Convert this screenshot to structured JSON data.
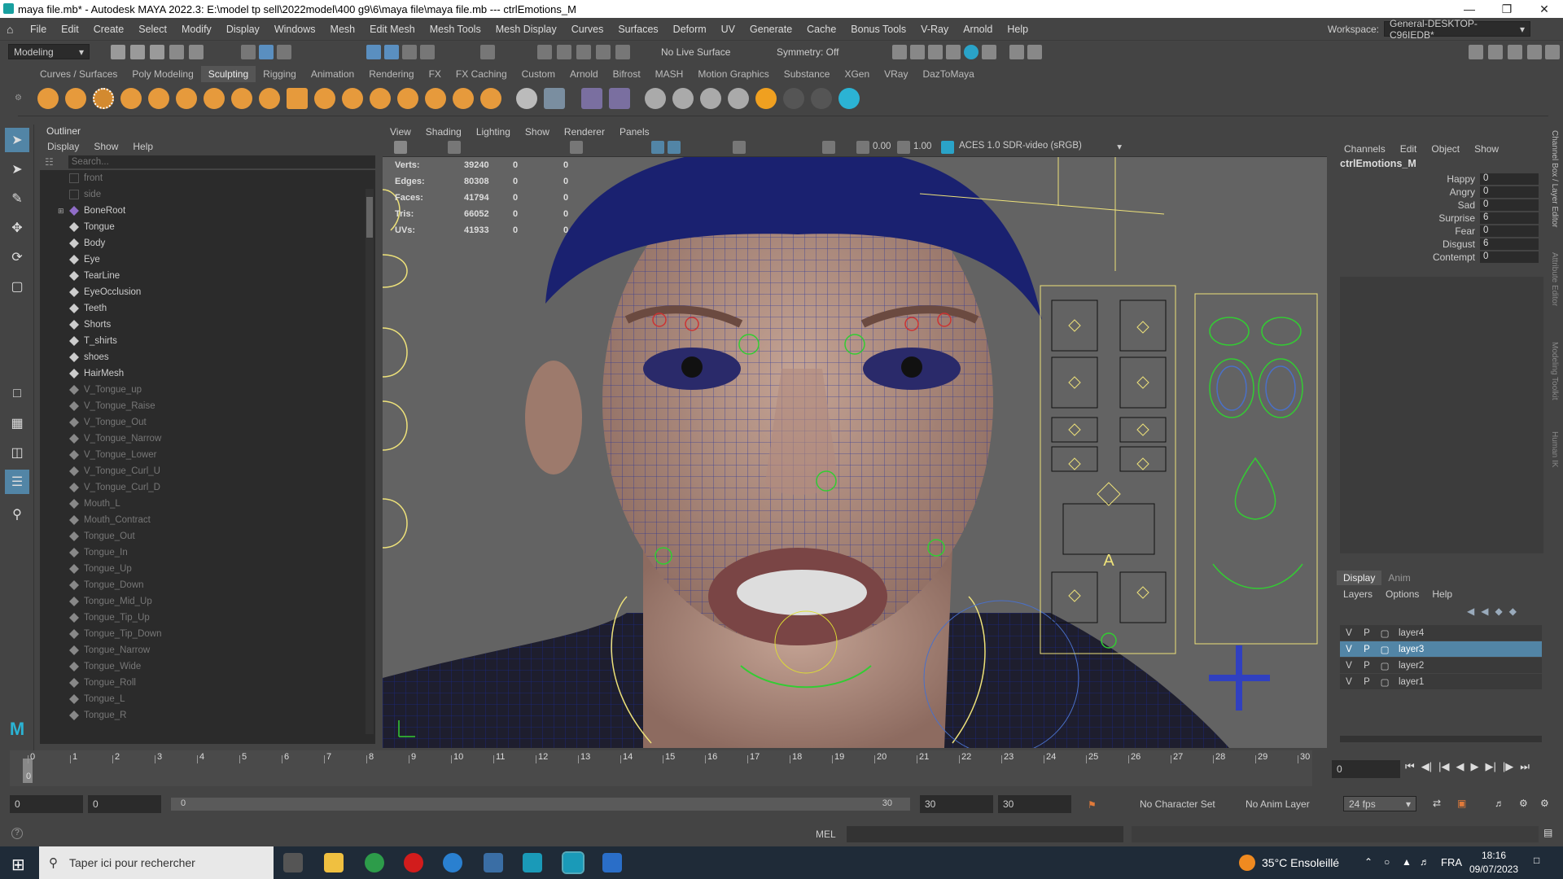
{
  "window": {
    "title": "maya file.mb* - Autodesk MAYA 2022.3: E:\\model tp sell\\2022model\\400 g9\\6\\maya file\\maya file.mb  ---  ctrlEmotions_M"
  },
  "menubar": {
    "items": [
      "File",
      "Edit",
      "Create",
      "Select",
      "Modify",
      "Display",
      "Windows",
      "Mesh",
      "Edit Mesh",
      "Mesh Tools",
      "Mesh Display",
      "Curves",
      "Surfaces",
      "Deform",
      "UV",
      "Generate",
      "Cache",
      "Bonus Tools",
      "V-Ray",
      "Arnold",
      "Help"
    ],
    "workspace_label": "Workspace:",
    "workspace_value": "General-DESKTOP-C96IEDB*"
  },
  "statusline": {
    "mode": "Modeling",
    "live_surface": "No Live Surface",
    "symmetry": "Symmetry: Off"
  },
  "shelf": {
    "tabs": [
      "Curves / Surfaces",
      "Poly Modeling",
      "Sculpting",
      "Rigging",
      "Animation",
      "Rendering",
      "FX",
      "FX Caching",
      "Custom",
      "Arnold",
      "Bifrost",
      "MASH",
      "Motion Graphics",
      "Substance",
      "XGen",
      "VRay",
      "DazToMaya"
    ],
    "selected_tab": "Sculpting"
  },
  "outliner": {
    "title": "Outliner",
    "menu": [
      "Display",
      "Show",
      "Help"
    ],
    "search_placeholder": "Search...",
    "items": [
      "front",
      "side",
      "BoneRoot",
      "Tongue",
      "Body",
      "Eye",
      "TearLine",
      "EyeOcclusion",
      "Teeth",
      "Shorts",
      "T_shirts",
      "shoes",
      "HairMesh",
      "V_Tongue_up",
      "V_Tongue_Raise",
      "V_Tongue_Out",
      "V_Tongue_Narrow",
      "V_Tongue_Lower",
      "V_Tongue_Curl_U",
      "V_Tongue_Curl_D",
      "Mouth_L",
      "Mouth_Contract",
      "Tongue_Out",
      "Tongue_In",
      "Tongue_Up",
      "Tongue_Down",
      "Tongue_Mid_Up",
      "Tongue_Tip_Up",
      "Tongue_Tip_Down",
      "Tongue_Narrow",
      "Tongue_Wide",
      "Tongue_Roll",
      "Tongue_L",
      "Tongue_R"
    ]
  },
  "viewport": {
    "menu": [
      "View",
      "Shading",
      "Lighting",
      "Show",
      "Renderer",
      "Panels"
    ],
    "exposure": "0.00",
    "gamma": "1.00",
    "colorspace": "ACES 1.0 SDR-video (sRGB)",
    "hud": [
      {
        "label": "Verts:",
        "v1": "39240",
        "v2": "0",
        "v3": "0"
      },
      {
        "label": "Edges:",
        "v1": "80308",
        "v2": "0",
        "v3": "0"
      },
      {
        "label": "Faces:",
        "v1": "41794",
        "v2": "0",
        "v3": "0"
      },
      {
        "label": "Tris:",
        "v1": "66052",
        "v2": "0",
        "v3": "0"
      },
      {
        "label": "UVs:",
        "v1": "41933",
        "v2": "0",
        "v3": "0"
      }
    ],
    "panel_letter": "A"
  },
  "channelbox": {
    "menu": [
      "Channels",
      "Edit",
      "Object",
      "Show"
    ],
    "node": "ctrlEmotions_M",
    "attrs": [
      {
        "name": "Happy",
        "value": "0"
      },
      {
        "name": "Angry",
        "value": "0"
      },
      {
        "name": "Sad",
        "value": "0"
      },
      {
        "name": "Surprise",
        "value": "6"
      },
      {
        "name": "Fear",
        "value": "0"
      },
      {
        "name": "Disgust",
        "value": "6"
      },
      {
        "name": "Contempt",
        "value": "0"
      }
    ],
    "side_tabs": [
      "Channel Box / Layer Editor",
      "Attribute Editor",
      "Modeling Toolkit",
      "Human IK"
    ]
  },
  "layers": {
    "tabs": [
      "Display",
      "Anim"
    ],
    "menu": [
      "Layers",
      "Options",
      "Help"
    ],
    "rows": [
      {
        "v": "V",
        "p": "P",
        "name": "layer4"
      },
      {
        "v": "V",
        "p": "P",
        "name": "layer3"
      },
      {
        "v": "V",
        "p": "P",
        "name": "layer2"
      },
      {
        "v": "V",
        "p": "P",
        "name": "layer1"
      }
    ],
    "selected": "layer3"
  },
  "timeline": {
    "ticks": [
      "0",
      "1",
      "2",
      "3",
      "4",
      "5",
      "6",
      "7",
      "8",
      "9",
      "10",
      "11",
      "12",
      "13",
      "14",
      "15",
      "16",
      "17",
      "18",
      "19",
      "20",
      "21",
      "22",
      "23",
      "24",
      "25",
      "26",
      "27",
      "28",
      "29",
      "30"
    ],
    "current_frame": "0",
    "current_frame_field": "0"
  },
  "range": {
    "start": "0",
    "anim_start": "0",
    "slider_start": "0",
    "slider_end": "30",
    "end": "30",
    "anim_end": "30",
    "character_set": "No Character Set",
    "anim_layer": "No Anim Layer",
    "fps": "24 fps"
  },
  "cmdline": {
    "lang": "MEL"
  },
  "taskbar": {
    "search": "Taper ici pour rechercher",
    "weather": "35°C  Ensoleillé",
    "lang": "FRA",
    "time": "18:16",
    "date": "09/07/2023"
  }
}
